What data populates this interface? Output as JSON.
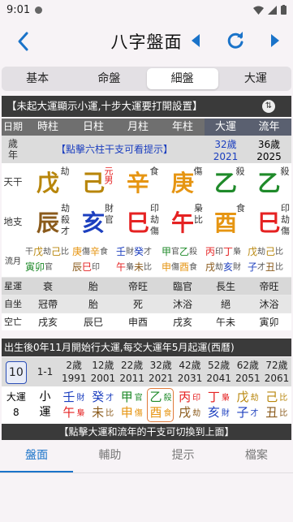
{
  "statusbar": {
    "time": "9:01"
  },
  "header": {
    "title": "八字盤面"
  },
  "tabs": [
    "基本",
    "命盤",
    "細盤",
    "大運"
  ],
  "notice": "【未起大運顯示小運,十步大運要打開設置】",
  "columns": [
    "日期",
    "時柱",
    "日柱",
    "月柱",
    "年柱",
    "大運",
    "流年"
  ],
  "age_row": {
    "label_top": "歲",
    "label_bottom": "年",
    "hint": "【點擊六柱干支可看提示】",
    "dayun_age": "32歲",
    "dayun_year": "2021",
    "liunian_age": "36歲",
    "liunian_year": "2025"
  },
  "gan_row": {
    "label": "天干",
    "cells": [
      {
        "char": "戊",
        "god": "劫"
      },
      {
        "char": "己",
        "god": "元男"
      },
      {
        "char": "辛",
        "god": "食"
      },
      {
        "char": "庚",
        "god": "傷"
      },
      {
        "char": "乙",
        "god": "殺"
      },
      {
        "char": "乙",
        "god": "殺"
      }
    ]
  },
  "zhi_row": {
    "label": "地支",
    "cells": [
      {
        "char": "辰",
        "gods": [
          "劫",
          "殺",
          "才"
        ]
      },
      {
        "char": "亥",
        "gods": [
          "財",
          "官"
        ]
      },
      {
        "char": "巳",
        "gods": [
          "印",
          "劫",
          "傷"
        ]
      },
      {
        "char": "午",
        "gods": [
          "梟",
          "比"
        ]
      },
      {
        "char": "酉",
        "gods": [
          "食"
        ]
      },
      {
        "char": "巳",
        "gods": [
          "印",
          "劫",
          "傷"
        ]
      }
    ]
  },
  "hidden_row": {
    "label": "流月",
    "cells": [
      {
        "line1": [
          [
            "干",
            "sm"
          ],
          [
            "戊",
            "c-gold"
          ],
          [
            "劫",
            "sm"
          ],
          [
            "己",
            "c-gold"
          ],
          [
            "比",
            "sm"
          ]
        ],
        "line2": [
          [
            "寅",
            "c-green"
          ],
          [
            "卯",
            "c-green"
          ],
          [
            "官",
            "sm"
          ]
        ]
      },
      {
        "line1": [
          [
            "庚",
            "c-orange"
          ],
          [
            "傷",
            "sm"
          ],
          [
            "辛",
            "c-orange"
          ],
          [
            "食",
            "sm"
          ]
        ],
        "line2": [
          [
            "辰",
            "c-brown"
          ],
          [
            "巳",
            "c-red"
          ],
          [
            "印",
            "sm"
          ]
        ]
      },
      {
        "line1": [
          [
            "壬",
            "c-blue"
          ],
          [
            "財",
            "sm"
          ],
          [
            "癸",
            "c-blue"
          ],
          [
            "才",
            "sm"
          ]
        ],
        "line2": [
          [
            "午",
            "c-red"
          ],
          [
            "梟",
            "sm"
          ],
          [
            "未",
            "c-brown"
          ],
          [
            "比",
            "sm"
          ]
        ]
      },
      {
        "line1": [
          [
            "甲",
            "c-green"
          ],
          [
            "官",
            "sm"
          ],
          [
            "乙",
            "c-green"
          ],
          [
            "殺",
            "sm"
          ]
        ],
        "line2": [
          [
            "申",
            "c-orange"
          ],
          [
            "傷",
            "sm"
          ],
          [
            "酉",
            "c-orange"
          ],
          [
            "食",
            "sm"
          ]
        ]
      },
      {
        "line1": [
          [
            "丙",
            "c-red"
          ],
          [
            "印",
            "sm"
          ],
          [
            "丁",
            "c-red"
          ],
          [
            "梟",
            "sm"
          ]
        ],
        "line2": [
          [
            "戌",
            "c-brown"
          ],
          [
            "劫",
            "sm"
          ],
          [
            "亥",
            "c-blue"
          ],
          [
            "財",
            "sm"
          ]
        ]
      },
      {
        "line1": [
          [
            "戊",
            "c-gold"
          ],
          [
            "劫",
            "sm"
          ],
          [
            "己",
            "c-gold"
          ],
          [
            "比",
            "sm"
          ]
        ],
        "line2": [
          [
            "子",
            "c-blue"
          ],
          [
            "才",
            "sm"
          ],
          [
            "丑",
            "c-brown"
          ],
          [
            "比",
            "sm"
          ]
        ]
      }
    ]
  },
  "stage_rows": [
    {
      "label": "星運",
      "cells": [
        "衰",
        "胎",
        "帝旺",
        "臨官",
        "長生",
        "帝旺"
      ]
    },
    {
      "label": "自坐",
      "cells": [
        "冠帶",
        "胎",
        "死",
        "沐浴",
        "絕",
        "沐浴"
      ]
    },
    {
      "label": "空亡",
      "cells": [
        "戌亥",
        "辰巳",
        "申酉",
        "戌亥",
        "午未",
        "寅卯"
      ]
    }
  ],
  "info_line": "出生後0年11月開始行大運,每交大運年5月起運(西曆)",
  "dayun_ages": [
    {
      "age": "10",
      "year": ""
    },
    {
      "age": "1-1",
      "year": ""
    },
    {
      "age": "2歲",
      "year": "1991"
    },
    {
      "age": "12歲",
      "year": "2001"
    },
    {
      "age": "22歲",
      "year": "2011"
    },
    {
      "age": "32歲",
      "year": "2021"
    },
    {
      "age": "42歲",
      "year": "2031"
    },
    {
      "age": "52歲",
      "year": "2041"
    },
    {
      "age": "62歲",
      "year": "2051"
    },
    {
      "age": "72歲",
      "year": "2061"
    }
  ],
  "dayun_pillars": {
    "label_top": "大運",
    "label_bottom": "8",
    "xiaoyun_top": "小",
    "xiaoyun_bottom": "運",
    "cells": [
      {
        "gan": "壬",
        "zhi": "午",
        "g1": "財",
        "g2": "梟"
      },
      {
        "gan": "癸",
        "zhi": "未",
        "g1": "才",
        "g2": "比"
      },
      {
        "gan": "甲",
        "zhi": "申",
        "g1": "官",
        "g2": "傷"
      },
      {
        "gan": "乙",
        "zhi": "酉",
        "g1": "殺",
        "g2": "食"
      },
      {
        "gan": "丙",
        "zhi": "戌",
        "g1": "印",
        "g2": "劫"
      },
      {
        "gan": "丁",
        "zhi": "亥",
        "g1": "梟",
        "g2": "財"
      },
      {
        "gan": "戊",
        "zhi": "子",
        "g1": "劫",
        "g2": "才"
      },
      {
        "gan": "己",
        "zhi": "丑",
        "g1": "比",
        "g2": "比"
      }
    ]
  },
  "bottom_hint": "【點擊大運和流年的干支可切換到上面】",
  "bottom_nav": [
    "盤面",
    "輔助",
    "提示",
    "檔案"
  ]
}
